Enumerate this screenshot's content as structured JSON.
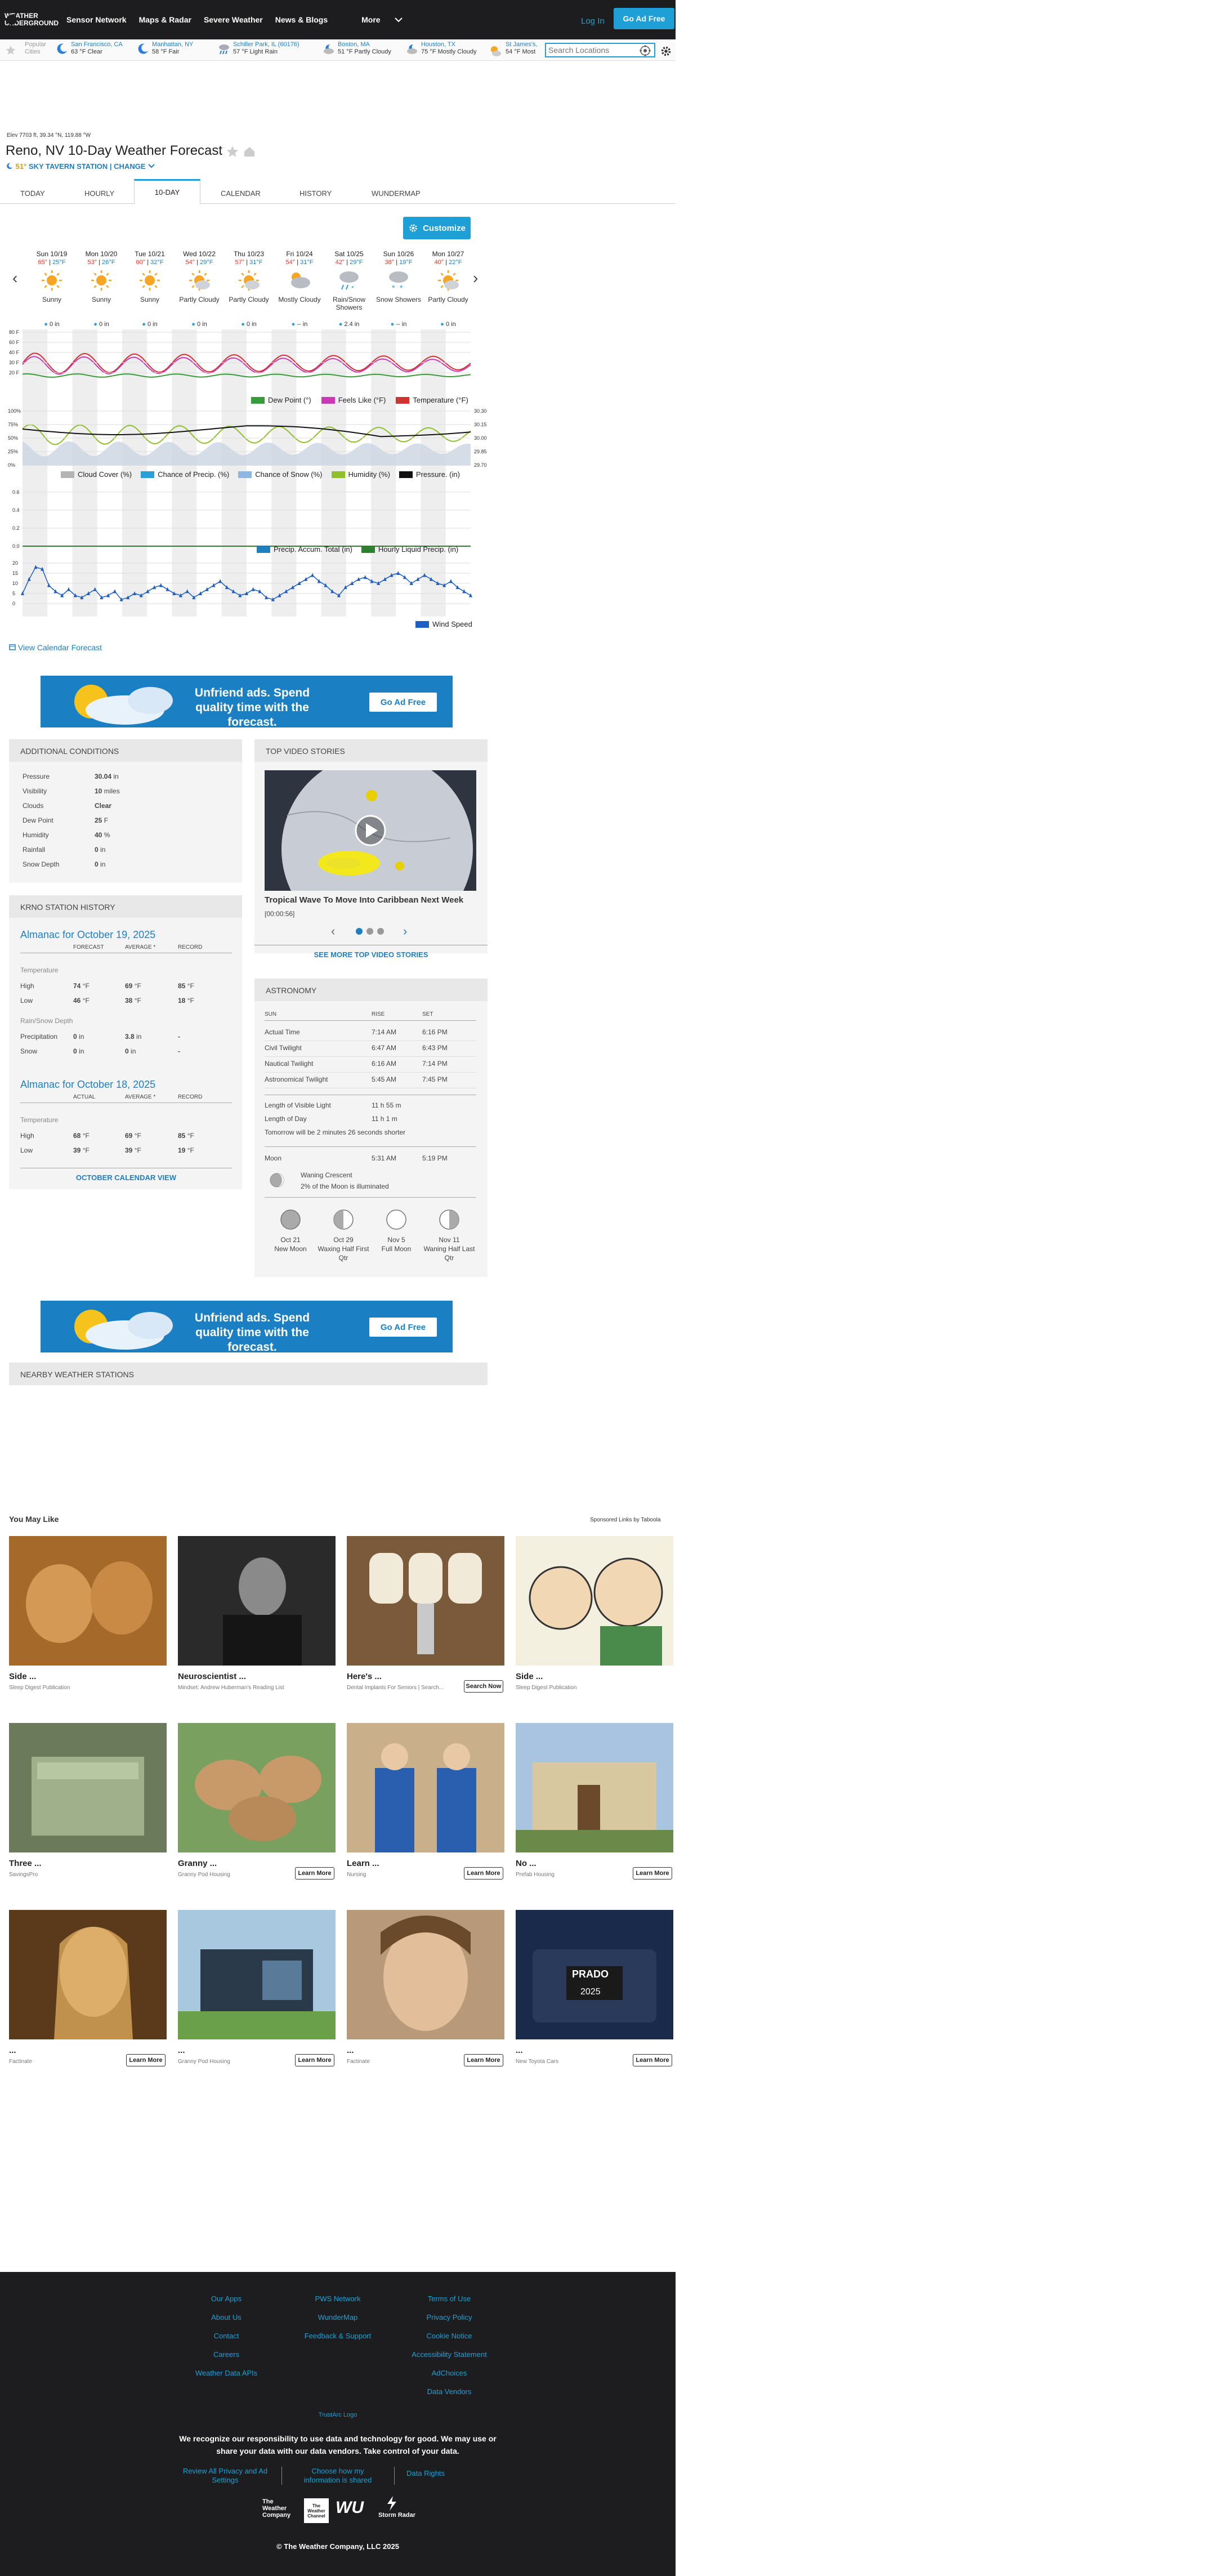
{
  "nav": {
    "logo_text": "WEATHER UNDERGROUND",
    "links": [
      "Sensor Network",
      "Maps & Radar",
      "Severe Weather",
      "News & Blogs",
      "More"
    ],
    "login": "Log In",
    "adfree": "Go Ad Free"
  },
  "citybar": {
    "popular": "Popular Cities",
    "cities": [
      {
        "name": "San Francisco, CA",
        "cond": "63 °F Clear",
        "icon": "moon-icon"
      },
      {
        "name": "Manhattan, NY",
        "cond": "58 °F Fair",
        "icon": "moon-icon"
      },
      {
        "name": "Schiller Park, IL (60176)",
        "cond": "57 °F Light Rain",
        "icon": "rain-icon"
      },
      {
        "name": "Boston, MA",
        "cond": "51 °F Partly Cloudy",
        "icon": "cloud-icon"
      },
      {
        "name": "Houston, TX",
        "cond": "75 °F Mostly Cloudy",
        "icon": "cloud-icon"
      },
      {
        "name": "St James's,",
        "cond": "54 °F Most",
        "icon": "sun-cloud-icon"
      }
    ],
    "search_placeholder": "Search Locations"
  },
  "header": {
    "elevation": "Elev 7703 ft, 39.34 °N, 119.88 °W",
    "title": "Reno, NV 10-Day Weather Forecast",
    "station_temp": "51°",
    "station_name": "SKY TAVERN STATION",
    "change": "CHANGE"
  },
  "tabs": [
    "TODAY",
    "HOURLY",
    "10-DAY",
    "CALENDAR",
    "HISTORY",
    "WUNDERMAP"
  ],
  "customize": "Customize",
  "days": [
    {
      "date": "Sun 10/19",
      "hi": "65°",
      "lo": "25°F",
      "cond": "Sunny",
      "precip": "0 in"
    },
    {
      "date": "Mon 10/20",
      "hi": "53°",
      "lo": "26°F",
      "cond": "Sunny",
      "precip": "0 in"
    },
    {
      "date": "Tue 10/21",
      "hi": "60°",
      "lo": "32°F",
      "cond": "Sunny",
      "precip": "0 in"
    },
    {
      "date": "Wed 10/22",
      "hi": "54°",
      "lo": "29°F",
      "cond": "Partly Cloudy",
      "precip": "0 in"
    },
    {
      "date": "Thu 10/23",
      "hi": "57°",
      "lo": "31°F",
      "cond": "Partly Cloudy",
      "precip": "0 in"
    },
    {
      "date": "Fri 10/24",
      "hi": "54°",
      "lo": "31°F",
      "cond": "Mostly Cloudy",
      "precip": "-- in"
    },
    {
      "date": "Sat 10/25",
      "hi": "42°",
      "lo": "29°F",
      "cond": "Rain/Snow Showers",
      "precip": "2.4 in"
    },
    {
      "date": "Sun 10/26",
      "hi": "38°",
      "lo": "19°F",
      "cond": "Snow Showers",
      "precip": "-- in"
    },
    {
      "date": "Mon 10/27",
      "hi": "40°",
      "lo": "22°F",
      "cond": "Partly Cloudy",
      "precip": "0 in"
    }
  ],
  "chart_data": [
    {
      "type": "line",
      "series": [
        {
          "name": "Dew Point (°)",
          "color": "#3a9b3a"
        },
        {
          "name": "Feels Like (°F)",
          "color": "#c83ab4"
        },
        {
          "name": "Temperature (°F)",
          "color": "#d23232"
        }
      ],
      "yticks": [
        "80 F",
        "60 F",
        "40 F",
        "30 F",
        "20 F"
      ]
    },
    {
      "type": "area",
      "series": [
        {
          "name": "Cloud Cover (%)",
          "color": "#b4b4b4"
        },
        {
          "name": "Chance of Precip. (%)",
          "color": "#2b9fd8"
        },
        {
          "name": "Chance of Snow (%)",
          "color": "#8fb6e0"
        },
        {
          "name": "Humidity (%)",
          "color": "#8fbf2a"
        },
        {
          "name": "Pressure. (in)",
          "color": "#111111"
        }
      ],
      "yticks": [
        "100%",
        "75%",
        "50%",
        "25%",
        "0%"
      ],
      "yticks_right": [
        "30.30",
        "30.15",
        "30.00",
        "29.85",
        "29.70"
      ]
    },
    {
      "type": "area",
      "series": [
        {
          "name": "Precip. Accum. Total (in)",
          "color": "#1e7fc1"
        },
        {
          "name": "Hourly Liquid Precip. (in)",
          "color": "#2f7f2f"
        }
      ],
      "yticks": [
        "0.6",
        "0.4",
        "0.2",
        "0.0"
      ]
    },
    {
      "type": "line",
      "series": [
        {
          "name": "Wind Speed",
          "color": "#1e5fc1"
        }
      ],
      "yticks": [
        "20",
        "15",
        "10",
        "5",
        "0"
      ],
      "values": [
        5,
        12,
        18,
        17,
        9,
        6,
        4,
        7,
        4,
        3,
        5,
        7,
        3,
        4,
        6,
        2,
        3,
        5,
        4,
        6,
        8,
        9,
        7,
        5,
        4,
        6,
        3,
        5,
        7,
        9,
        11,
        8,
        6,
        4,
        5,
        7,
        6,
        3,
        2,
        4,
        6,
        8,
        10,
        12,
        14,
        11,
        9,
        6,
        4,
        8,
        10,
        12,
        13,
        11,
        10,
        12,
        14,
        15,
        13,
        10,
        12,
        14,
        12,
        10,
        9,
        11,
        8,
        6,
        4
      ]
    }
  ],
  "view_calendar": "View Calendar Forecast",
  "ad": {
    "message": "Unfriend ads. Spend quality time with the forecast.",
    "button": "Go Ad Free"
  },
  "conditions": {
    "title": "ADDITIONAL CONDITIONS",
    "rows": [
      {
        "label": "Pressure",
        "value": "30.04",
        "unit": "in"
      },
      {
        "label": "Visibility",
        "value": "10",
        "unit": "miles"
      },
      {
        "label": "Clouds",
        "value": "Clear",
        "unit": ""
      },
      {
        "label": "Dew Point",
        "value": "25",
        "unit": "F"
      },
      {
        "label": "Humidity",
        "value": "40",
        "unit": "%"
      },
      {
        "label": "Rainfall",
        "value": "0",
        "unit": "in"
      },
      {
        "label": "Snow Depth",
        "value": "0",
        "unit": "in"
      }
    ]
  },
  "history": {
    "title": "KRNO STATION HISTORY",
    "almanac1": {
      "title": "Almanac for October 19, 2025",
      "cols": [
        "FORECAST",
        "AVERAGE *",
        "RECORD"
      ],
      "temp_label": "Temperature",
      "high": [
        "High",
        "74",
        "69",
        "85"
      ],
      "low": [
        "Low",
        "46",
        "38",
        "18"
      ],
      "rain_label": "Rain/Snow Depth",
      "precip": [
        "Precipitation",
        "0",
        "3.8",
        "-"
      ],
      "snow": [
        "Snow",
        "0",
        "0",
        "-"
      ]
    },
    "almanac2": {
      "title": "Almanac for October 18, 2025",
      "cols": [
        "ACTUAL",
        "AVERAGE *",
        "RECORD"
      ],
      "temp_label": "Temperature",
      "high": [
        "High",
        "68",
        "69",
        "85"
      ],
      "low": [
        "Low",
        "39",
        "39",
        "19"
      ]
    },
    "calendar_link": "OCTOBER CALENDAR VIEW"
  },
  "video": {
    "title": "TOP VIDEO STORIES",
    "story": "Tropical Wave To Move Into Caribbean Next Week",
    "duration": "[00:00:56]",
    "more": "SEE MORE TOP VIDEO STORIES"
  },
  "astronomy": {
    "title": "ASTRONOMY",
    "cols": [
      "SUN",
      "RISE",
      "SET"
    ],
    "rows": [
      [
        "Actual Time",
        "7:14 AM",
        "6:16 PM"
      ],
      [
        "Civil Twilight",
        "6:47 AM",
        "6:43 PM"
      ],
      [
        "Nautical Twilight",
        "6:16 AM",
        "7:14 PM"
      ],
      [
        "Astronomical Twilight",
        "5:45 AM",
        "7:45 PM"
      ]
    ],
    "visible": [
      "Length of Visible Light",
      "11 h 55 m"
    ],
    "day": [
      "Length of Day",
      "11 h 1 m"
    ],
    "tomorrow": "Tomorrow will be 2 minutes 26 seconds shorter",
    "moon": [
      "Moon",
      "5:31 AM",
      "5:19 PM"
    ],
    "moon_phase": "Waning Crescent",
    "moon_illum": "2% of the Moon is illuminated",
    "phases": [
      {
        "date": "Oct 21",
        "name": "New Moon"
      },
      {
        "date": "Oct 29",
        "name": "Waxing Half First Qtr"
      },
      {
        "date": "Nov 5",
        "name": "Full Moon"
      },
      {
        "date": "Nov 11",
        "name": "Waning Half Last Qtr"
      }
    ]
  },
  "nearby": "NEARBY WEATHER STATIONS",
  "sponsored": {
    "title": "You May Like",
    "label": "Sponsored Links by Taboola",
    "items": [
      {
        "title": "Side ...",
        "src": "Sleep Digest Publication",
        "cta": ""
      },
      {
        "title": "Neuroscientist ...",
        "src": "Mindset: Andrew Huberman's Reading List",
        "cta": ""
      },
      {
        "title": "Here's ...",
        "src": "Dental Implants For Seniors | Search...",
        "cta": "Search Now"
      },
      {
        "title": "Side ...",
        "src": "Sleep Digest Publication",
        "cta": ""
      },
      {
        "title": "Three ...",
        "src": "SavingsPro",
        "cta": ""
      },
      {
        "title": "Granny ...",
        "src": "Granny Pod Housing",
        "cta": "Learn More"
      },
      {
        "title": "Learn ...",
        "src": "Nursing",
        "cta": "Learn More"
      },
      {
        "title": "No ...",
        "src": "Prefab Housing",
        "cta": "Learn More"
      },
      {
        "title": "...",
        "src": "Factinate",
        "cta": "Learn More"
      },
      {
        "title": "...",
        "src": "Granny Pod Housing",
        "cta": "Learn More"
      },
      {
        "title": "...",
        "src": "Factinate",
        "cta": "Learn More"
      },
      {
        "title": "...",
        "src": "New Toyota Cars",
        "cta": "Learn More"
      }
    ]
  },
  "footer": {
    "col1": [
      "Our Apps",
      "About Us",
      "Contact",
      "Careers",
      "Weather Data APIs"
    ],
    "col2": [
      "PWS Network",
      "WunderMap",
      "Feedback & Support"
    ],
    "col3": [
      "Terms of Use",
      "Privacy Policy",
      "Cookie Notice",
      "Accessibility Statement",
      "AdChoices",
      "Data Vendors"
    ],
    "ccpa": "TrustArc Logo",
    "note": "We recognize our responsibility to use data and technology for good. We may use or share your data with our data vendors. Take control of your data.",
    "bottom": [
      "Review All Privacy and Ad Settings",
      "Choose how my information is shared",
      "Data Rights"
    ],
    "brands": [
      "The Weather Company",
      "The Weather Channel",
      "WU",
      "Storm Radar"
    ],
    "copyright": "© The Weather Company, LLC 2025"
  }
}
